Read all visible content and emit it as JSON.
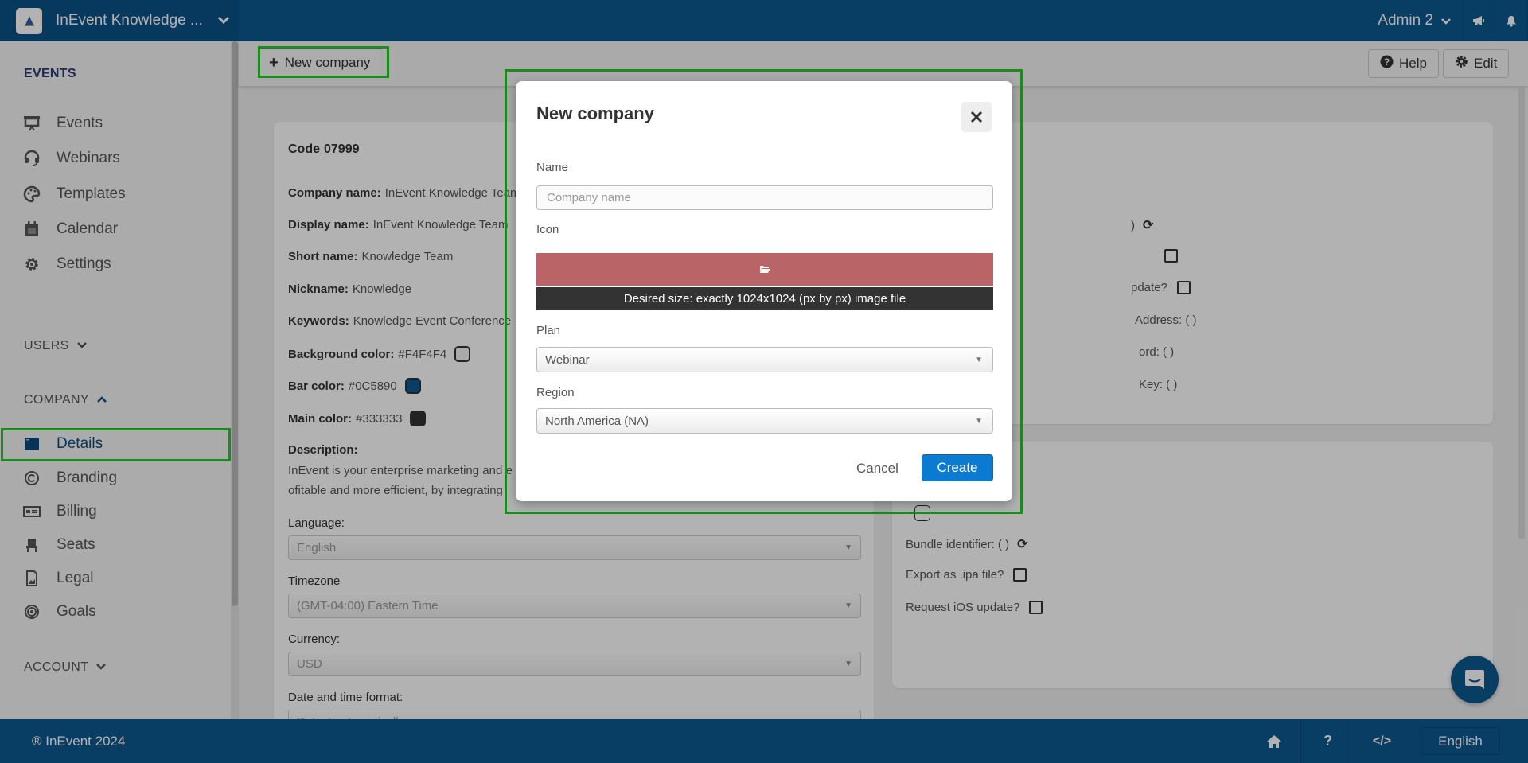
{
  "topbar": {
    "brand_title": "InEvent Knowledge ...",
    "user_label": "Admin 2",
    "icons": [
      "megaphone-icon",
      "bell-icon"
    ]
  },
  "sidebar": {
    "sections": {
      "events": "EVENTS",
      "users": "USERS",
      "company": "COMPANY",
      "account": "ACCOUNT"
    },
    "events_items": [
      {
        "label": "Events",
        "icon": "presentation-icon"
      },
      {
        "label": "Webinars",
        "icon": "headset-icon"
      },
      {
        "label": "Templates",
        "icon": "palette-icon"
      },
      {
        "label": "Calendar",
        "icon": "calendar-icon"
      },
      {
        "label": "Settings",
        "icon": "gear-icon"
      }
    ],
    "company_items": [
      {
        "label": "Details",
        "icon": "window-icon",
        "active": true
      },
      {
        "label": "Branding",
        "icon": "copyright-icon"
      },
      {
        "label": "Billing",
        "icon": "money-bill-icon"
      },
      {
        "label": "Seats",
        "icon": "chair-icon"
      },
      {
        "label": "Legal",
        "icon": "document-icon"
      },
      {
        "label": "Goals",
        "icon": "target-icon"
      }
    ]
  },
  "toolbar": {
    "new_company": "New company",
    "help": "Help",
    "edit": "Edit"
  },
  "details": {
    "code_label": "Code",
    "code_value": "07999",
    "fields": [
      {
        "label": "Company name:",
        "value": "InEvent Knowledge Team"
      },
      {
        "label": "Display name:",
        "value": "InEvent Knowledge Team"
      },
      {
        "label": "Short name:",
        "value": "Knowledge Team"
      },
      {
        "label": "Nickname:",
        "value": "Knowledge"
      },
      {
        "label": "Keywords:",
        "value": "Knowledge Event Conference"
      }
    ],
    "colors": [
      {
        "label": "Background color:",
        "value": "#F4F4F4",
        "swatch": "#F4F4F4"
      },
      {
        "label": "Bar color:",
        "value": "#0C5890",
        "swatch": "#0C5890"
      },
      {
        "label": "Main color:",
        "value": "#333333",
        "swatch": "#333333"
      }
    ],
    "description_label": "Description:",
    "description_line1": "InEvent is your enterprise marketing and e",
    "description_line2": "ofitable and more efficient, by integrating",
    "language_label": "Language:",
    "language_value": "English",
    "timezone_label": "Timezone",
    "timezone_value": "(GMT-04:00) Eastern Time",
    "currency_label": "Currency:",
    "currency_value": "USD",
    "datetime_label": "Date and time format:",
    "datetime_value": "Detect automatically"
  },
  "right_panel_top": {
    "rows": [
      {
        "label": ")",
        "trailing": "refresh"
      },
      {
        "label": "",
        "trailing": "checkbox"
      },
      {
        "label": "pdate?",
        "trailing": "checkbox"
      },
      {
        "label": "Address: ( )"
      },
      {
        "label": "ord: ( )"
      },
      {
        "label": "Key: ( )"
      }
    ]
  },
  "right_panel_bottom": {
    "bundle_label": "Bundle identifier: ( )",
    "export_label": "Export as .ipa file?",
    "ios_update_label": "Request iOS update?"
  },
  "modal": {
    "title": "New company",
    "name_label": "Name",
    "name_placeholder": "Company name",
    "name_value": "",
    "icon_label": "Icon",
    "upload_icon": "folder-open-icon",
    "upload_hint": "Desired size: exactly 1024x1024 (px by px) image file",
    "plan_label": "Plan",
    "plan_value": "Webinar",
    "region_label": "Region",
    "region_value": "North America (NA)",
    "cancel": "Cancel",
    "create": "Create"
  },
  "footer": {
    "copyright": "® InEvent 2024",
    "language": "English"
  },
  "colors": {
    "brand_bar": "#0C5890",
    "primary_button": "#0B7AD1",
    "upload_bar": "#B96568",
    "highlight": "#1C8A1C"
  }
}
